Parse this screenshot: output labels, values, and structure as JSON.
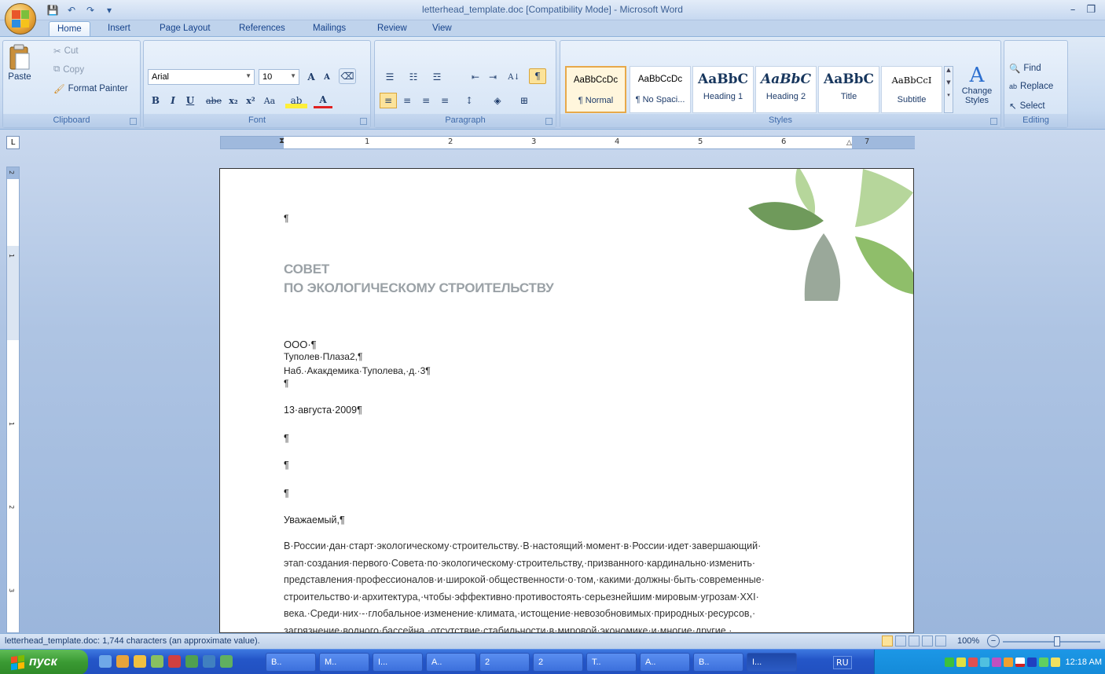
{
  "window": {
    "title": "letterhead_template.doc [Compatibility Mode] - Microsoft Word",
    "minimize": "–",
    "restore": "❐"
  },
  "qat": {
    "save": "💾",
    "undo": "↶",
    "redo": "↷",
    "more": "▾"
  },
  "tabs": [
    "Home",
    "Insert",
    "Page Layout",
    "References",
    "Mailings",
    "Review",
    "View"
  ],
  "clipboard": {
    "paste": "Paste",
    "cut": "Cut",
    "copy": "Copy",
    "format_painter": "Format Painter",
    "label": "Clipboard"
  },
  "font": {
    "name": "Arial",
    "size": "10",
    "bold": "B",
    "italic": "I",
    "underline": "U",
    "strike": "abe",
    "subscript": "x₂",
    "superscript": "x²",
    "change_case": "Aa",
    "grow": "A",
    "shrink": "A",
    "label": "Font"
  },
  "paragraph": {
    "label": "Paragraph",
    "show_marks": "¶",
    "sort": "A↓"
  },
  "styles": {
    "label": "Styles",
    "items": [
      {
        "sample": "AaBbCcDc",
        "name": "¶ Normal"
      },
      {
        "sample": "AaBbCcDc",
        "name": "¶ No Spaci..."
      },
      {
        "sample": "AaBbC",
        "name": "Heading 1"
      },
      {
        "sample": "AaBbC",
        "name": "Heading 2"
      },
      {
        "sample": "AaBbC",
        "name": "Title"
      },
      {
        "sample": "AaBbCcI",
        "name": "Subtitle"
      }
    ],
    "change_styles": "Change Styles"
  },
  "editing": {
    "find": "Find",
    "replace": "Replace",
    "select": "Select",
    "label": "Editing"
  },
  "ruler": {
    "numbers": [
      "1",
      "2",
      "3",
      "4",
      "5",
      "6",
      "7"
    ],
    "vnumbers": [
      "2",
      "1",
      "1",
      "2",
      "3"
    ]
  },
  "document": {
    "empty1": "¶",
    "org_line1": "СОВЕТ",
    "org_line2": "ПО ЭКОЛОГИЧЕСКОМУ СТРОИТЕЛЬСТВУ",
    "addr1": "ООО·¶",
    "addr2": "Туполев·Плаза2,¶",
    "addr3": "Наб.·Акакдемика·Туполева,·д.·3¶",
    "empty2": "¶",
    "date": "13·августа·2009¶",
    "empty3": "¶",
    "empty4": "¶",
    "empty5": "¶",
    "greeting": "Уважаемый,¶",
    "body_lines": [
      "В·России·дан·старт·экологическому·строительству.·В·настоящий·момент·в·России·идет·завершающий·",
      "этап·создания·первого·Совета·по·экологическому·строительству,·призванного·кардинально·изменить·",
      "представления·профессионалов·и·широкой·общественности·о·том,·какими·должны·быть·современные·",
      "строительство·и·архитектура,·чтобы·эффективно·противостоять·серьезнейшим·мировым·угрозам·XXI·",
      "века.·Среди·них·-·глобальное·изменение·климата,·истощение·невозобновимых·природных·ресурсов,·",
      "загрязнение·водного·бассейна,·отсутствие·стабильности·в·мировой·экономике·и·многие·другие.·"
    ]
  },
  "status": {
    "text": "letterhead_template.doc: 1,744 characters (an approximate value).",
    "zoom": "100%"
  },
  "taskbar": {
    "start": "пуск",
    "buttons": [
      "B..",
      "M..",
      "I...",
      "A..",
      "2",
      "2",
      "T..",
      "A..",
      "B..",
      "I..."
    ],
    "lang": "RU",
    "clock": "12:18 AM"
  },
  "colors": {
    "leaf_light": "#b6d69b",
    "leaf_mid": "#8fbe6a",
    "leaf_dark": "#6f9a5b",
    "leaf_grey": "#9aa89a",
    "org_grey": "#9aa1a6"
  }
}
